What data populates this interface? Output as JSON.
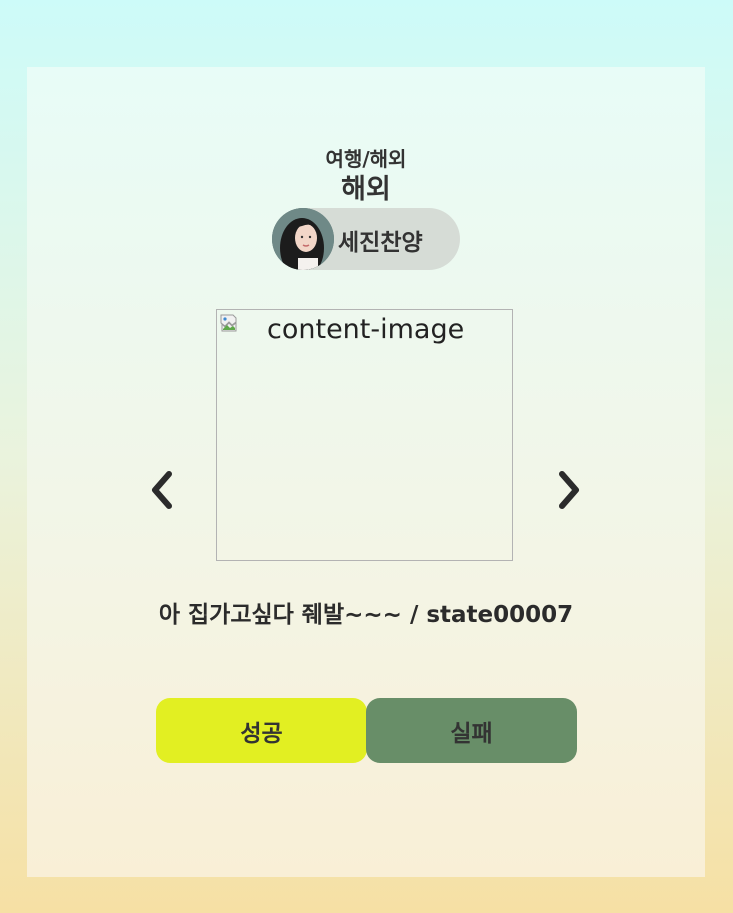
{
  "card": {
    "category": "여행/해외",
    "subcategory": "해외",
    "user": {
      "name": "세진찬양",
      "avatar_icon": "user-avatar-photo"
    },
    "image": {
      "alt": "content-image",
      "icon": "broken-image-icon"
    },
    "nav": {
      "prev_icon": "chevron-left-icon",
      "next_icon": "chevron-right-icon"
    },
    "caption": "아 집가고싶다 줴발~~~ / state00007",
    "actions": {
      "success_label": "성공",
      "fail_label": "실패"
    }
  },
  "colors": {
    "success": "#e2ef22",
    "fail": "#688e68",
    "pill": "#d6dcd6"
  }
}
